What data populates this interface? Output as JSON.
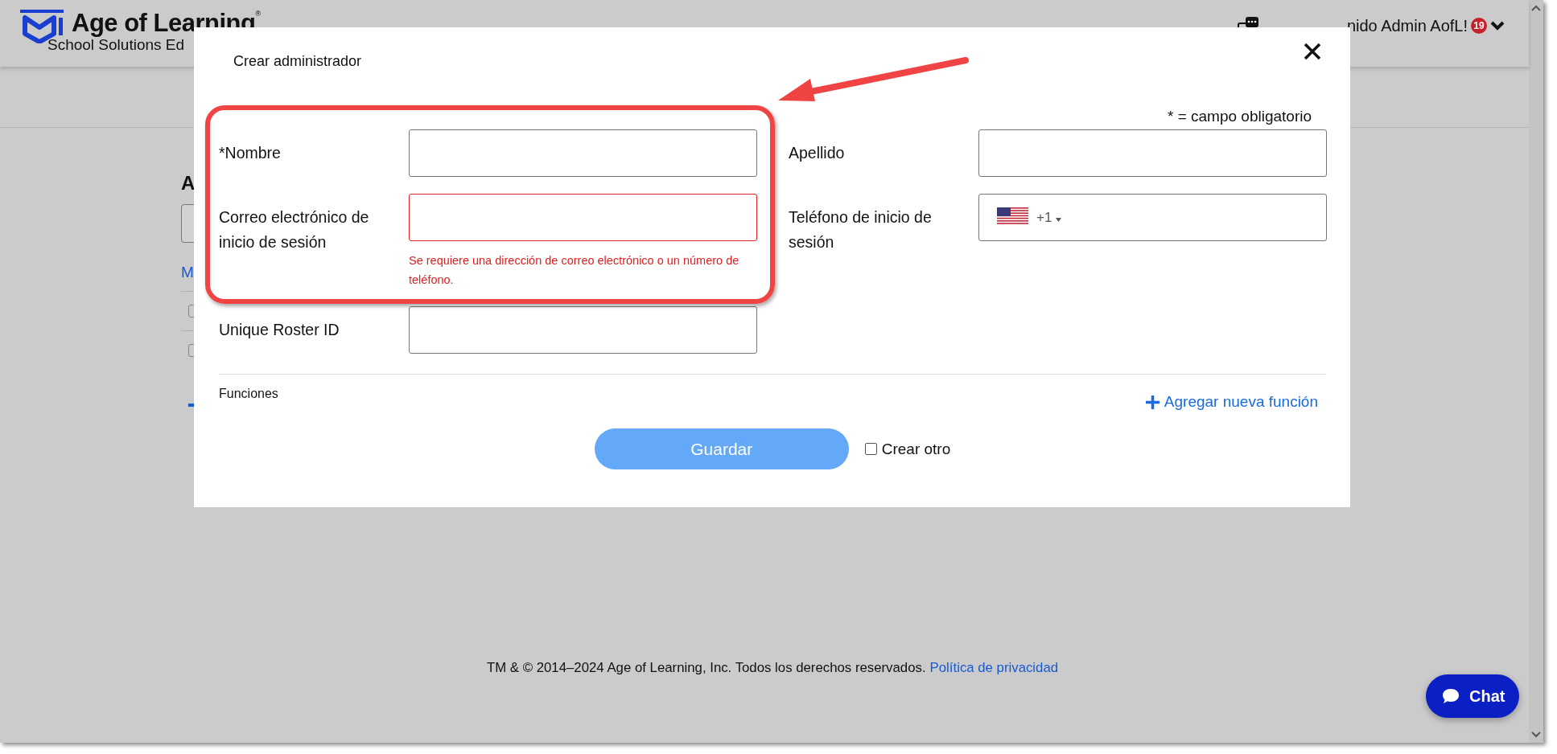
{
  "header": {
    "logo_title": "Age of Learning",
    "logo_mark": "®",
    "logo_subtitle": "School Solutions Ed",
    "greeting": "nido Admin AofL!",
    "notification_count": "19"
  },
  "background": {
    "heading": "A",
    "link": "M",
    "rows": [
      {
        "checked": false
      },
      {
        "checked": false
      }
    ]
  },
  "modal": {
    "title": "Crear administrador",
    "required_note": "* = campo obligatorio",
    "fields": [
      {
        "label": "*Nombre",
        "kind": "text",
        "invalid": false
      },
      {
        "label": "Apellido",
        "kind": "text",
        "invalid": false
      },
      {
        "label": "Correo electrónico de inicio de sesión",
        "kind": "text",
        "invalid": true,
        "error": "Se requiere una dirección de correo electrónico o un número de teléfono."
      },
      {
        "label": "Teléfono de inicio de sesión",
        "kind": "phone",
        "invalid": false,
        "dial_code": "+1"
      },
      {
        "label": "Unique Roster ID",
        "kind": "text",
        "invalid": false
      }
    ],
    "section_label": "Funciones",
    "add_role": "Agregar nueva función",
    "save": "Guardar",
    "create_another": {
      "label": "Crear otro",
      "checked": false
    }
  },
  "footer": {
    "copyright": "TM & © 2014–2024 Age of Learning, Inc. Todos los derechos reservados.",
    "privacy_link": "Política de privacidad"
  },
  "chat": {
    "label": "Chat"
  }
}
